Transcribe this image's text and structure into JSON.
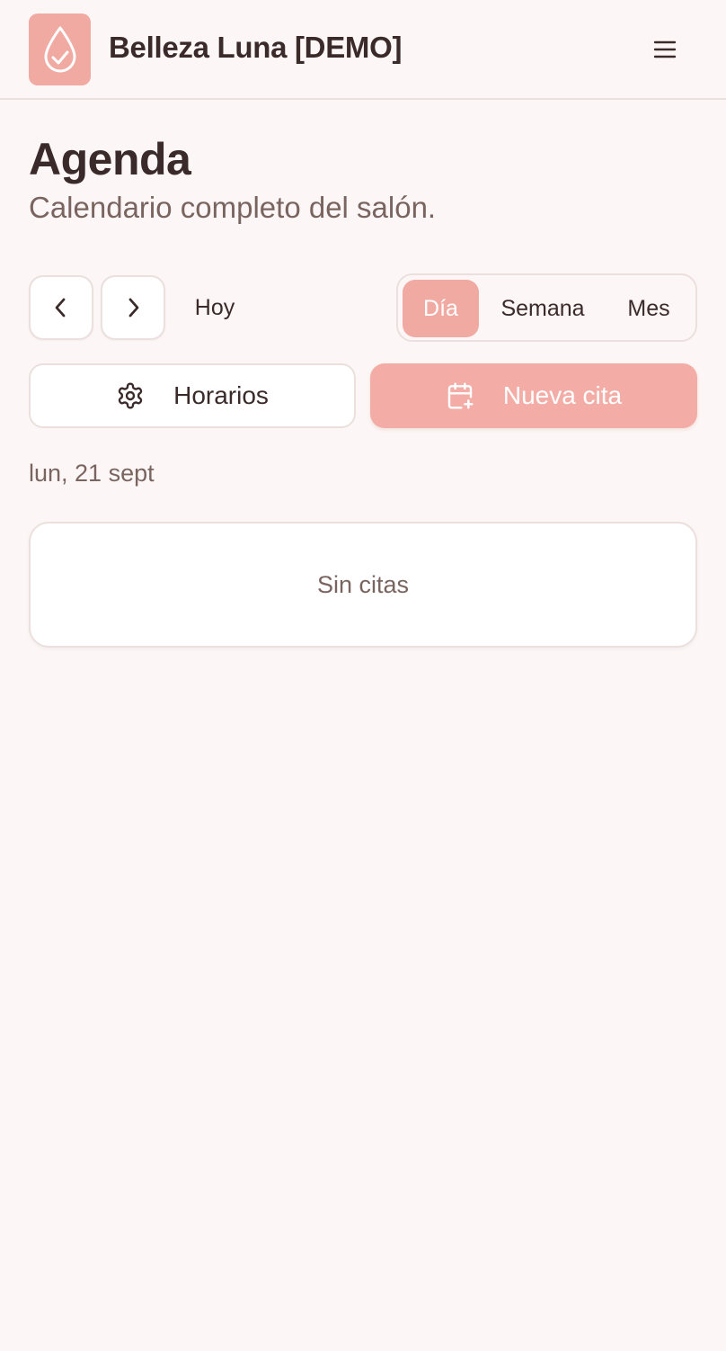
{
  "header": {
    "app_title": "Belleza Luna [DEMO]",
    "logo_icon": "droplet-check-icon",
    "menu_icon": "hamburger-menu-icon"
  },
  "page": {
    "title": "Agenda",
    "subtitle": "Calendario completo del salón."
  },
  "navigation": {
    "prev_icon": "chevron-left-icon",
    "next_icon": "chevron-right-icon",
    "today_label": "Hoy"
  },
  "view_toggle": {
    "options": [
      "Día",
      "Semana",
      "Mes"
    ],
    "selected": "Día"
  },
  "actions": {
    "schedules_label": "Horarios",
    "schedules_icon": "gear-icon",
    "new_appointment_label": "Nueva cita",
    "new_appointment_icon": "calendar-plus-icon"
  },
  "day": {
    "date_label": "lun, 21 sept",
    "empty_text": "Sin citas"
  },
  "colors": {
    "accent": "#f1aaa2",
    "background": "#fcf7f6",
    "text": "#3b2a2a",
    "muted_text": "#7a6460",
    "border": "#ebe0de"
  }
}
